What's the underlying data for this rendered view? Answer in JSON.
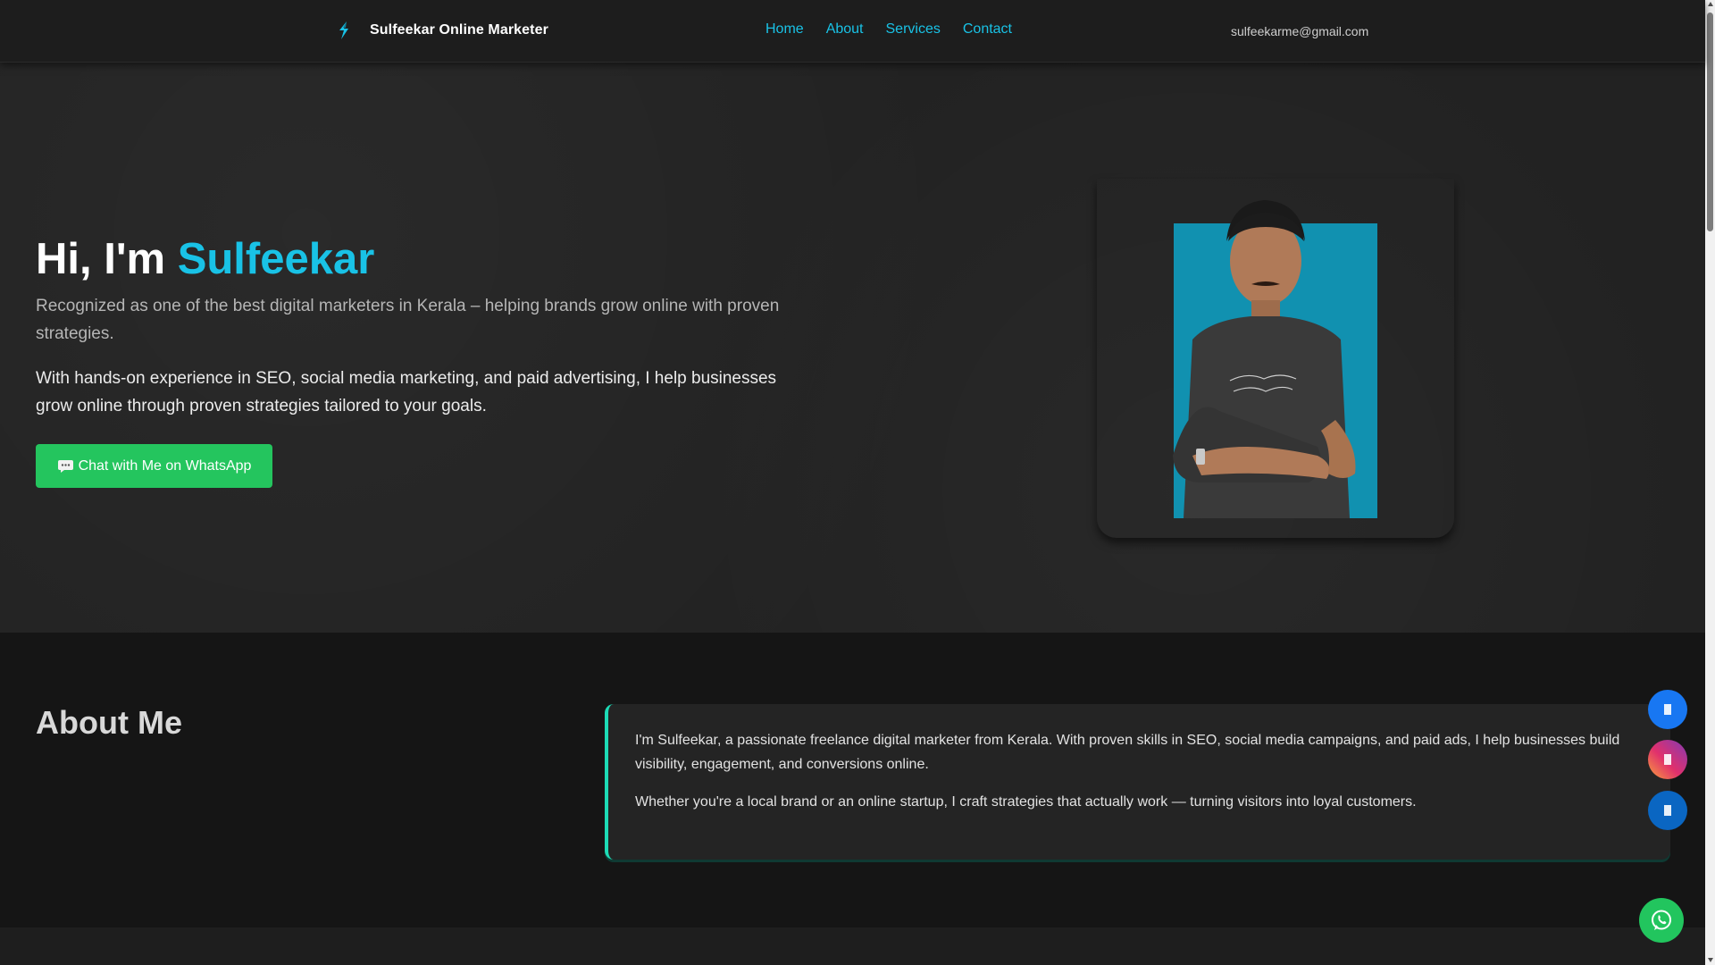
{
  "header": {
    "brand_name": "Sulfeekar Online Marketer",
    "brand_icon": "lightning-s-logo-icon",
    "nav": [
      {
        "label": "Home"
      },
      {
        "label": "About"
      },
      {
        "label": "Services"
      },
      {
        "label": "Contact"
      }
    ],
    "email": "sulfeekarme@gmail.com"
  },
  "hero": {
    "title_prefix": "Hi, I'm ",
    "title_name": "Sulfeekar",
    "subtitle": "Recognized as one of the best digital marketers in Kerala – helping brands grow online with proven strategies.",
    "description": "With hands-on experience in SEO, social media marketing, and paid advertising, I help businesses grow online through proven strategies tailored to your goals.",
    "cta_label": "Chat with Me on WhatsApp",
    "cta_icon": "chat-bubble-icon"
  },
  "about": {
    "title": "About Me",
    "paragraphs": [
      "I'm Sulfeekar, a passionate freelance digital marketer from Kerala. With proven skills in SEO, social media campaigns, and paid ads, I help businesses build visibility, engagement, and conversions online.",
      "Whether you're a local brand or an online startup, I craft strategies that actually work — turning visitors into loyal customers."
    ]
  },
  "floating": {
    "social": [
      "facebook-icon",
      "instagram-icon",
      "linkedin-icon"
    ],
    "whatsapp": "whatsapp-icon"
  },
  "colors": {
    "accent": "#19c2e6",
    "whatsapp_green": "#24c55e",
    "about_border": "#1ddbb6",
    "background": "#222222"
  }
}
